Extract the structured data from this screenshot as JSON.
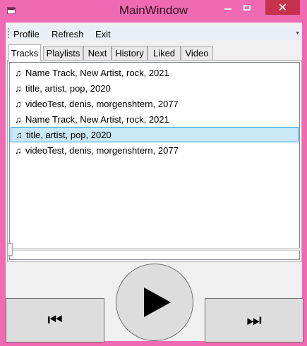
{
  "window": {
    "title": "MainWindow",
    "minimize_glyph": "–",
    "maximize_glyph": "□",
    "close_glyph": "✕"
  },
  "menu": {
    "items": [
      {
        "label": "Profile"
      },
      {
        "label": "Refresh"
      },
      {
        "label": "Exit"
      }
    ],
    "overflow_glyph": "▼"
  },
  "tabs": [
    {
      "label": "Tracks",
      "active": true
    },
    {
      "label": "Playlists",
      "active": false
    },
    {
      "label": "Next",
      "active": false
    },
    {
      "label": "History",
      "active": false
    },
    {
      "label": "Liked",
      "active": false
    },
    {
      "label": "Video",
      "active": false
    }
  ],
  "tracks": [
    {
      "icon": "♫",
      "text": "Name Track, New Artist, rock, 2021",
      "selected": false
    },
    {
      "icon": "♫",
      "text": "title, artist, pop, 2020",
      "selected": false
    },
    {
      "icon": "♫",
      "text": "videoTest, denis, morgenshtern, 2077",
      "selected": false
    },
    {
      "icon": "♫",
      "text": "Name Track, New Artist, rock, 2021",
      "selected": false
    },
    {
      "icon": "♫",
      "text": "title, artist, pop, 2020",
      "selected": true
    },
    {
      "icon": "♫",
      "text": "videoTest, denis, morgenshtern, 2077",
      "selected": false
    }
  ],
  "player": {
    "position": 0,
    "prev_glyph": "⏮",
    "play_icon": "play-icon",
    "next_glyph": "⏭"
  },
  "colors": {
    "window_frame": "#f06ab3",
    "close_button": "#c6324d",
    "selection_fill": "#cbe8f6",
    "selection_border": "#26a0da"
  }
}
